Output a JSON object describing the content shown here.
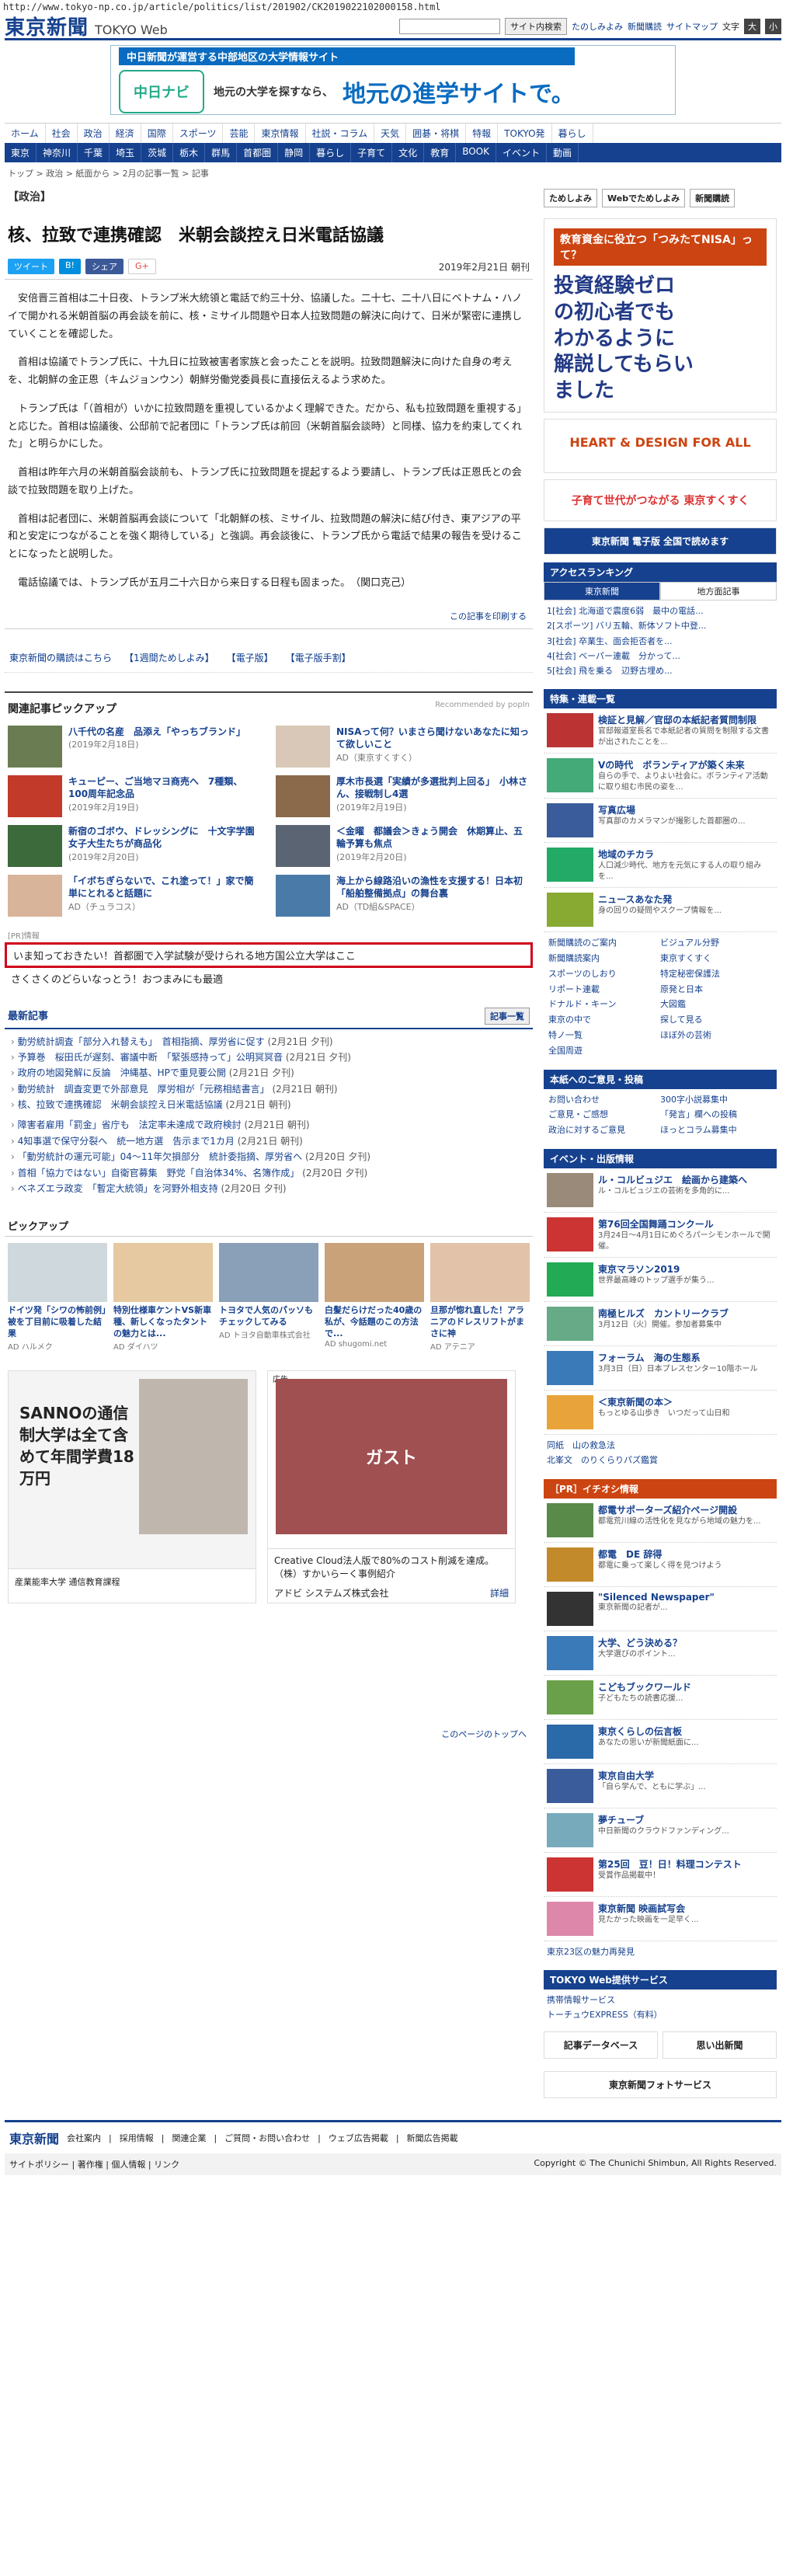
{
  "url": "http://www.tokyo-np.co.jp/article/politics/list/201902/CK2019022102000158.html",
  "header": {
    "logo_jp": "東京新聞",
    "logo_web": "TOKYO Web",
    "search_button": "サイト内検索",
    "links": [
      "たのしみよみ",
      "新聞購読",
      "サイトマップ"
    ],
    "text_size_label": "文字",
    "size_buttons": [
      "大",
      "小"
    ]
  },
  "banner": {
    "tag": "中日新聞が運営する中部地区の大学情報サイト",
    "logo": "中日ナビ",
    "sub": "地元の大学を探すなら、",
    "main": "地元の進学サイトで。"
  },
  "nav1": [
    "ホーム",
    "社会",
    "政治",
    "経済",
    "国際",
    "スポーツ",
    "芸能",
    "東京情報",
    "社説・コラム",
    "天気",
    "囲碁・将棋",
    "特報",
    "TOKYO発",
    "暮らし"
  ],
  "nav2": [
    "東京",
    "神奈川",
    "千葉",
    "埼玉",
    "茨城",
    "栃木",
    "群馬",
    "首都圏",
    "静岡",
    "暮らし",
    "子育て",
    "文化",
    "教育",
    "BOOK",
    "イベント",
    "動画"
  ],
  "breadcrumb": "トップ > 政治 > 紙面から > 2月の記事一覧 > 記事",
  "section": "【政治】",
  "article": {
    "title": "核、拉致で連携確認　米朝会談控え日米電話協議",
    "share": [
      "ツイート",
      "B!",
      "シェア",
      "G+"
    ],
    "date": "2019年2月21日 朝刊",
    "paragraphs": [
      "安倍晋三首相は二十日夜、トランプ米大統領と電話で約三十分、協議した。二十七、二十八日にベトナム・ハノイで開かれる米朝首脳の再会談を前に、核・ミサイル問題や日本人拉致問題の解決に向けて、日米が緊密に連携していくことを確認した。",
      "首相は協議でトランプ氏に、十九日に拉致被害者家族と会ったことを説明。拉致問題解決に向けた自身の考えを、北朝鮮の金正恩（キムジョンウン）朝鮮労働党委員長に直接伝えるよう求めた。",
      "トランプ氏は「（首相が）いかに拉致問題を重視しているかよく理解できた。だから、私も拉致問題を重視する」と応じた。首相は協議後、公邸前で記者団に「トランプ氏は前回（米朝首脳会談時）と同様、協力を約束してくれた」と明らかにした。",
      "首相は昨年六月の米朝首脳会談前も、トランプ氏に拉致問題を提起するよう要請し、トランプ氏は正恩氏との会談で拉致問題を取り上げた。",
      "首相は記者団に、米朝首脳再会談について「北朝鮮の核、ミサイル、拉致問題の解決に結び付き、東アジアの平和と安定につながることを強く期待している」と強調。再会談後に、トランプ氏から電話で結果の報告を受けることになったと説明した。",
      "電話協議では、トランプ氏が五月二十六日から来日する日程も固まった。　（関口克己）"
    ],
    "print_link": "この記事を印刷する"
  },
  "links_row": [
    "東京新聞の購読はこちら",
    "【1週間ためしよみ】",
    "【電子版】",
    "【電子版手割】"
  ],
  "related": {
    "heading": "関連記事ピックアップ",
    "recommended": "Recommended by popIn",
    "items": [
      {
        "title": "八千代の名産　品添え「やっちブランド」",
        "date": "(2019年2月18日)"
      },
      {
        "title": "NISAって何？いまさら聞けないあなたに知って欲しいこと",
        "date": "AD（東京すくすく）"
      },
      {
        "title": "キューピー、ご当地マヨ商売へ　7種類、100周年記念品",
        "date": "(2019年2月19日)"
      },
      {
        "title": "厚木市長選「実績が多選批判上回る」　小林さん、接戦制し4選",
        "date": "(2019年2月19日)"
      },
      {
        "title": "新宿のゴボウ、ドレッシングに　十文字学園女子大生たちが商品化",
        "date": "(2019年2月20日)"
      },
      {
        "title": "＜金曜　都議会＞きょう開会　休期算止、五輪予算も焦点",
        "date": "(2019年2月20日)"
      },
      {
        "title": "「イボちぎらないで、これ塗って！」家で簡単にとれると話題に",
        "date": "AD（チュラコス）"
      },
      {
        "title": "海上から線路沿いの漁性を支援する！日本初「船舶整備拠点」の舞台裏",
        "date": "AD（TD組&SPACE）"
      }
    ]
  },
  "pr": {
    "label": "[PR]情報",
    "links": [
      "いま知っておきたい！首都圏で入学試験が受けられる地方国公立大学はここ",
      "さくさくのどらいなっとう！おつまみにも最適"
    ]
  },
  "latest": {
    "heading": "最新記事",
    "more": "記事一覧",
    "group1": [
      {
        "t": "動労統計調査「部分入れ替えも」　首相指摘、厚労省に促す",
        "d": "(2月21日 夕刊)"
      },
      {
        "t": "予算巻　桜田氏が遅刻、審議中断　「緊張感持って」公明冥冥音",
        "d": "(2月21日 夕刊)"
      },
      {
        "t": "政府の地図発解に反論　沖縄基、HPで重見要公開",
        "d": "(2月21日 夕刊)"
      },
      {
        "t": "動労統計　調査変更で外部意見　厚労相が「元務相結書言」",
        "d": "(2月21日 朝刊)"
      },
      {
        "t": "核、拉致で連携確認　米朝会談控え日米電話協議",
        "d": "(2月21日 朝刊)"
      }
    ],
    "group2": [
      {
        "t": "障害者雇用「罰金」省庁も　法定率未達成で政府検討",
        "d": "(2月21日 朝刊)"
      },
      {
        "t": "4知事選で保守分裂へ　統一地方選　告示まで1カ月",
        "d": "(2月21日 朝刊)"
      },
      {
        "t": "「動労統計の運元可能」04〜11年欠損部分　統計委指摘、厚労省へ",
        "d": "(2月20日 夕刊)"
      },
      {
        "t": "首相「協力ではない」自衛官募集　野党「自治体34%、名簿作成」",
        "d": "(2月20日 夕刊)"
      },
      {
        "t": "ベネズエラ政変　「暫定大統領」を河野外相支持",
        "d": "(2月20日 夕刊)"
      }
    ]
  },
  "pickup": {
    "heading": "ピックアップ",
    "items": [
      {
        "t": "ドイツ発「シワの怖前例」被を丁目前に吸着した結果",
        "a": "AD ハルメク"
      },
      {
        "t": "特別仕様車ケントVS新車種、新しくなったタントの魅力とは...",
        "a": "AD ダイハツ"
      },
      {
        "t": "トヨタで人気のパッソもチェックしてみる",
        "a": "AD トヨタ自動車株式会社"
      },
      {
        "t": "白髪だらけだった40歳の私が、今話題のこの方法で...",
        "a": "AD shugomi.net"
      },
      {
        "t": "旦那が惚れ直した！アラニアのドレスリフトがまさに神",
        "a": "AD アテニア"
      }
    ]
  },
  "ads": {
    "ad1_text": "SANNOの通信制大学は全て含めて年間学費18万円",
    "ad1_foot": "産業能率大学 通信教育課程",
    "ad2_label": "広告",
    "ad2_shop": "ガスト",
    "ad2_caption": "Creative Cloud法人版で80%のコスト削減を達成。（株）すかいらーく事例紹介",
    "ad2_sponsor": "アドビ システムズ株式会社",
    "ad2_more": "詳細"
  },
  "to_top": "このページのトップへ",
  "sidebar": {
    "links": [
      "ためしよみ",
      "Webでためしよみ",
      "新聞購読"
    ],
    "ad_tag": "教育資金に役立つ「つみたてNISA」って？",
    "ad_msg": "投資経験ゼロの初心者でもわかるように解説してもらいました",
    "box1": "HEART & DESIGN FOR ALL",
    "box2": "子育て世代がつながる 東京すくすく",
    "box3": "東京新聞 電子版 全国で読めます",
    "ranking_head": "アクセスランキング",
    "ranking_tabs": [
      "東京新聞",
      "地方面記事"
    ],
    "ranking": [
      "1[社会] 北海道で震度6弱　最中の電話...",
      "2[スポーツ] バリ五輪、新体ソフト中登...",
      "3[社会] 卒業生、面会拒否者を...",
      "4[社会] ベーパー連載　分かって...",
      "5[社会] 飛を乗る　辺野古埋め..."
    ],
    "tokuho_head": "特集・連載一覧",
    "features": [
      {
        "t": "検証と見解／官邸の本紙記者質問制限",
        "d": "官邸報道室長名で本紙記者の質問を制限する文書が出されたことを..."
      },
      {
        "t": "Vの時代　ボランティアが築く未来",
        "d": "自らの手で、よりよい社会に。ボランティア活動に取り組む市民の姿を..."
      },
      {
        "t": "写真広場",
        "d": "写真部のカメラマンが撮影した首都圏の..."
      },
      {
        "t": "地域のチカラ",
        "d": "人口減少時代、地方を元気にする人の取り組みを..."
      },
      {
        "t": "ニュースあなた発",
        "d": "身の回りの疑問やスクープ情報を..."
      }
    ],
    "misc_links": [
      "新聞購読のご案内",
      "ビジュアル分野",
      "新聞購読案内",
      "東京すくすく",
      "スポーツのしおり",
      "特定秘密保護法",
      "リポート連載",
      "原発と日本",
      "ドナルド・キーン",
      "大図鑑",
      "東京の中で",
      "探して見る",
      "特ノ一覧",
      "ほぼ外の芸術",
      "全国周遊"
    ],
    "contact_head": "本紙へのご意見・投稿",
    "contact": [
      "お問い合わせ",
      "300字小説募集中",
      "ご意見・ご感想",
      "「発言」欄への投稿",
      "政治に対するご意見",
      "ほっとコラム募集中"
    ],
    "event_head": "イベント・出版情報",
    "events": [
      {
        "t": "ル・コルビュジエ　絵画から建築へ",
        "d": "ル・コルビュジエの芸術を多角的に..."
      },
      {
        "t": "第76回全国舞踊コンクール",
        "d": "3月24日〜4月1日にめぐろパーシモンホールで開催。"
      },
      {
        "t": "東京マラソン2019",
        "d": "世界最高峰のトップ選手が集う..."
      },
      {
        "t": "南極ヒルズ　カントリークラブ",
        "d": "3月12日（火）開催。参加者募集中"
      },
      {
        "t": "フォーラム　海の生態系",
        "d": "3月3日（日）日本プレスセンター10階ホール"
      },
      {
        "t": "＜東京新聞の本＞",
        "d": "もっとゆる山歩き　いつだって山日和"
      }
    ],
    "bottom_links": [
      "同紙　山の救急法",
      "北峯文　のりくらりパズ鑑賞"
    ],
    "pr_head": "［PR］イチオシ情報",
    "pr_items": [
      {
        "t": "都電サポーターズ紹介ページ開設",
        "d": "都電荒川線の活性化を見ながら地域の魅力を..."
      },
      {
        "t": "都電　DE 辞得",
        "d": "都電に乗って楽しく得を見つけよう"
      },
      {
        "t": "\"Silenced Newspaper\"",
        "d": "東京新聞の記者が..."
      },
      {
        "t": "大学、どう決める？",
        "d": "大学選びのポイント..."
      },
      {
        "t": "こどもブックワールド",
        "d": "子どもたちの読書応援..."
      },
      {
        "t": "東京くらしの伝言板",
        "d": "あなたの思いが新聞紙面に..."
      },
      {
        "t": "東京自由大学",
        "d": "「自ら学んで、ともに学ぶ」..."
      },
      {
        "t": "夢チューブ",
        "d": "中日新聞のクラウドファンディング..."
      },
      {
        "t": "第25回　豆！日！料理コンテスト",
        "d": "受賞作品掲載中！"
      },
      {
        "t": "東京新聞 映画試写会",
        "d": "見たかった映画を一足早く..."
      }
    ],
    "photo_service": "東京23区の魅力再発見",
    "web_service_head": "TOKYO Web提供サービス",
    "web_services": [
      "携帯情報サービス",
      "トーチュウEXPRESS（有料）"
    ],
    "db_label": "記事データベース",
    "omoide": "思い出新聞",
    "photo_sale": "東京新聞フォトサービス"
  },
  "footer": {
    "logo": "東京新聞",
    "links": [
      "会社案内",
      "採用情報",
      "関連企業",
      "ご質問・お問い合わせ",
      "ウェブ広告掲載",
      "新聞広告掲載"
    ],
    "bottom_links": "サイトポリシー | 著作権 | 個人情報 | リンク",
    "copyright": "Copyright © The Chunichi Shimbun, All Rights Reserved."
  }
}
